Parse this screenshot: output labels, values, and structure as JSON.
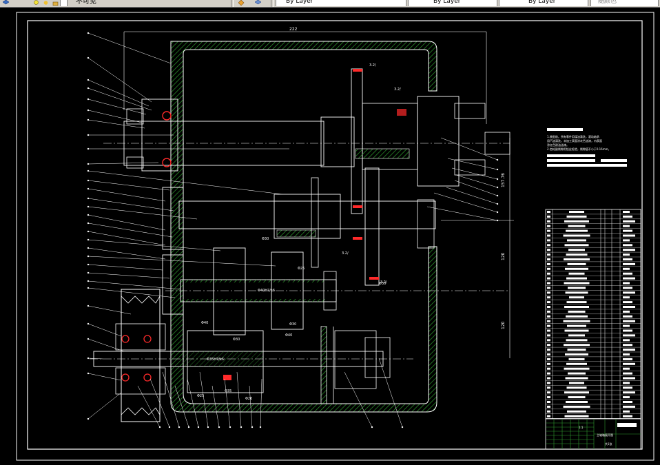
{
  "toolbar": {
    "file_menu_label": "不可见",
    "combo_1": "By Layer",
    "combo_2": "By Layer",
    "combo_3": "By Layer",
    "combo_4": "随颜色"
  },
  "drawing": {
    "dim_top_width": "222",
    "dim_right_1": "157.76",
    "dim_right_2": "120",
    "dim_right_3": "120",
    "roughness_1": "3.2/",
    "roughness_2": "3.2/",
    "roughness_3": "3.2/",
    "roughness_4": "3.2/",
    "fit_1": "Φ30",
    "fit_2": "Φ25",
    "fit_3": "Φ40",
    "fit_4": "Φ30",
    "fit_5": "Φ30",
    "fit_6": "Φ40",
    "fit_7": "Φ25",
    "fit_8": "Φ35",
    "fit_9": "Φ20",
    "fit_10": "Φ30",
    "shaft_label_1": "Φ40H7/k6",
    "shaft_label_2": "Φ35H7/k6",
    "tech_title": "技术要求",
    "tech_line_1": "1.装配前，所有零件用煤油清洗，滚动轴承",
    "tech_line_2": "用汽油清洗，未加工表面涂灰色油漆，内表面",
    "tech_line_3": "涂红色耐油油漆。",
    "tech_line_4": "2.齿轮副侧隙用铅丝检验，侧隙值不小于0.16mm。",
    "title_block_name": "主轴箱展开图",
    "title_block_school": "",
    "title_scale": "1:1",
    "title_sheet": "共1张"
  },
  "colors": {
    "background": "#000000",
    "outline": "#ffffff",
    "hatch": "#2e9b2e",
    "bearing_red": "#ff2a2a",
    "toolbar_bg": "#d4d0c8"
  }
}
